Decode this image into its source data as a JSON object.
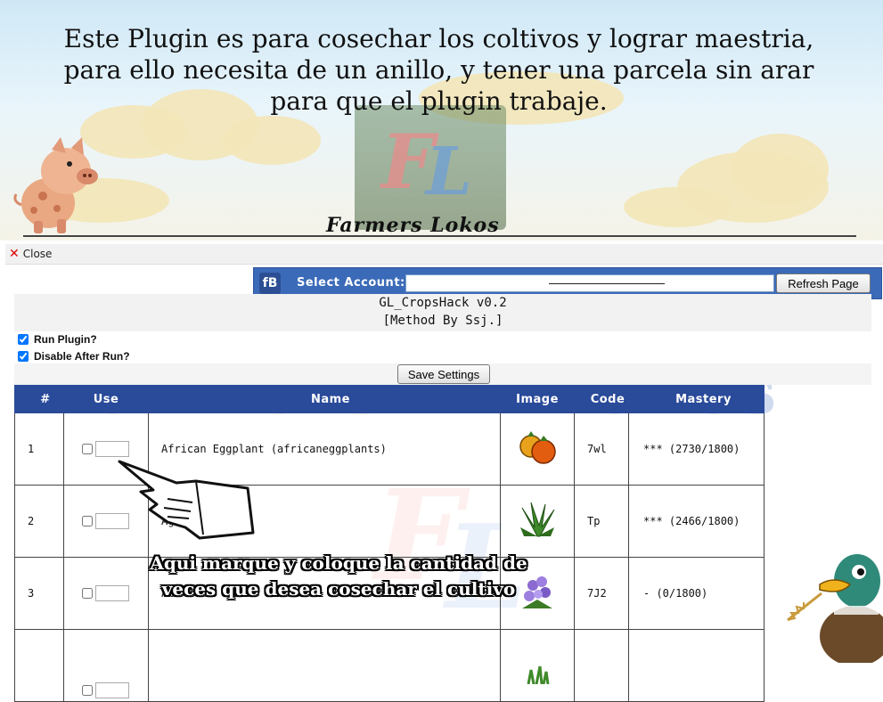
{
  "banner": {
    "text": "Este Plugin es para  cosechar los coltivos y lograr maestria, para ello necesita de un anillo, y tener una parcela sin arar para que el plugin trabaje.",
    "brand": "Farmers Lokos",
    "logo_letters": {
      "f": "F",
      "l": "L"
    }
  },
  "close_bar": {
    "label": "Close",
    "icon": "close-icon"
  },
  "account": {
    "icon_text": "fB",
    "label": "Select Account:",
    "selected": "",
    "refresh_label": "Refresh Page"
  },
  "plugin": {
    "title": "GL_CropsHack v0.2",
    "author": "[Method By Ssj.]",
    "options": [
      {
        "label": "Run Plugin?",
        "checked": true
      },
      {
        "label": "Disable After Run?",
        "checked": true
      }
    ],
    "save_label": "Save Settings"
  },
  "watermark": {
    "left": "Farmers",
    "right": "Lokos"
  },
  "table": {
    "headers": [
      "#",
      "Use",
      "Name",
      "Image",
      "Code",
      "Mastery"
    ],
    "rows": [
      {
        "num": "1",
        "name": "African Eggplant (africaneggplants)",
        "image": "eggplant-icon",
        "code": "7wl",
        "mastery": "*** (2730/1800)"
      },
      {
        "num": "2",
        "name": "Agav",
        "image": "agave-icon",
        "code": "Tp",
        "mastery": "*** (2466/1800)"
      },
      {
        "num": "3",
        "name": "Al",
        "image": "flower-icon",
        "code": "7J2",
        "mastery": "- (0/1800)"
      },
      {
        "num": "",
        "name": "",
        "image": "grass-icon",
        "code": "",
        "mastery": ""
      }
    ]
  },
  "annotation": "Aqui marque y coloque la cantidad de veces que desea cosechar el cultivo",
  "colors": {
    "header_blue": "#2a4a9a",
    "account_bar": "#3b6ab8"
  }
}
